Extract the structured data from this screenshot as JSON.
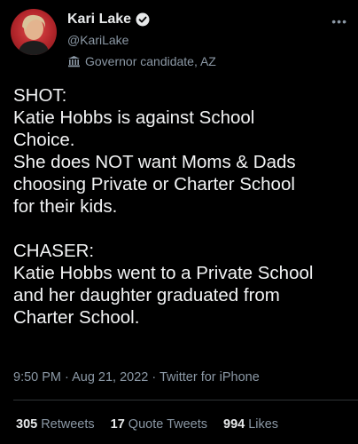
{
  "author": {
    "name": "Kari Lake",
    "handle": "@KariLake",
    "label": "Governor candidate, AZ"
  },
  "tweet": {
    "paragraph1": [
      "SHOT:",
      "Katie Hobbs is against School",
      "Choice.",
      "She does NOT want Moms & Dads",
      "choosing Private or Charter School",
      "for their kids."
    ],
    "paragraph2": [
      "CHASER:",
      "Katie Hobbs went to a Private School",
      "and her daughter graduated from",
      "Charter School."
    ]
  },
  "meta": "9:50 PM · Aug 21, 2022 · Twitter for iPhone",
  "stats": {
    "retweets_count": "305",
    "retweets_label": "Retweets",
    "quotes_count": "17",
    "quotes_label": "Quote Tweets",
    "likes_count": "994",
    "likes_label": "Likes"
  },
  "icons": {
    "verified": "verified-badge-icon",
    "label": "government-building-icon",
    "more": "more-options-icon"
  },
  "colors": {
    "background": "#000000",
    "text": "#e7e9ea",
    "secondary": "#8b98a5",
    "avatar": "#c0282d"
  }
}
